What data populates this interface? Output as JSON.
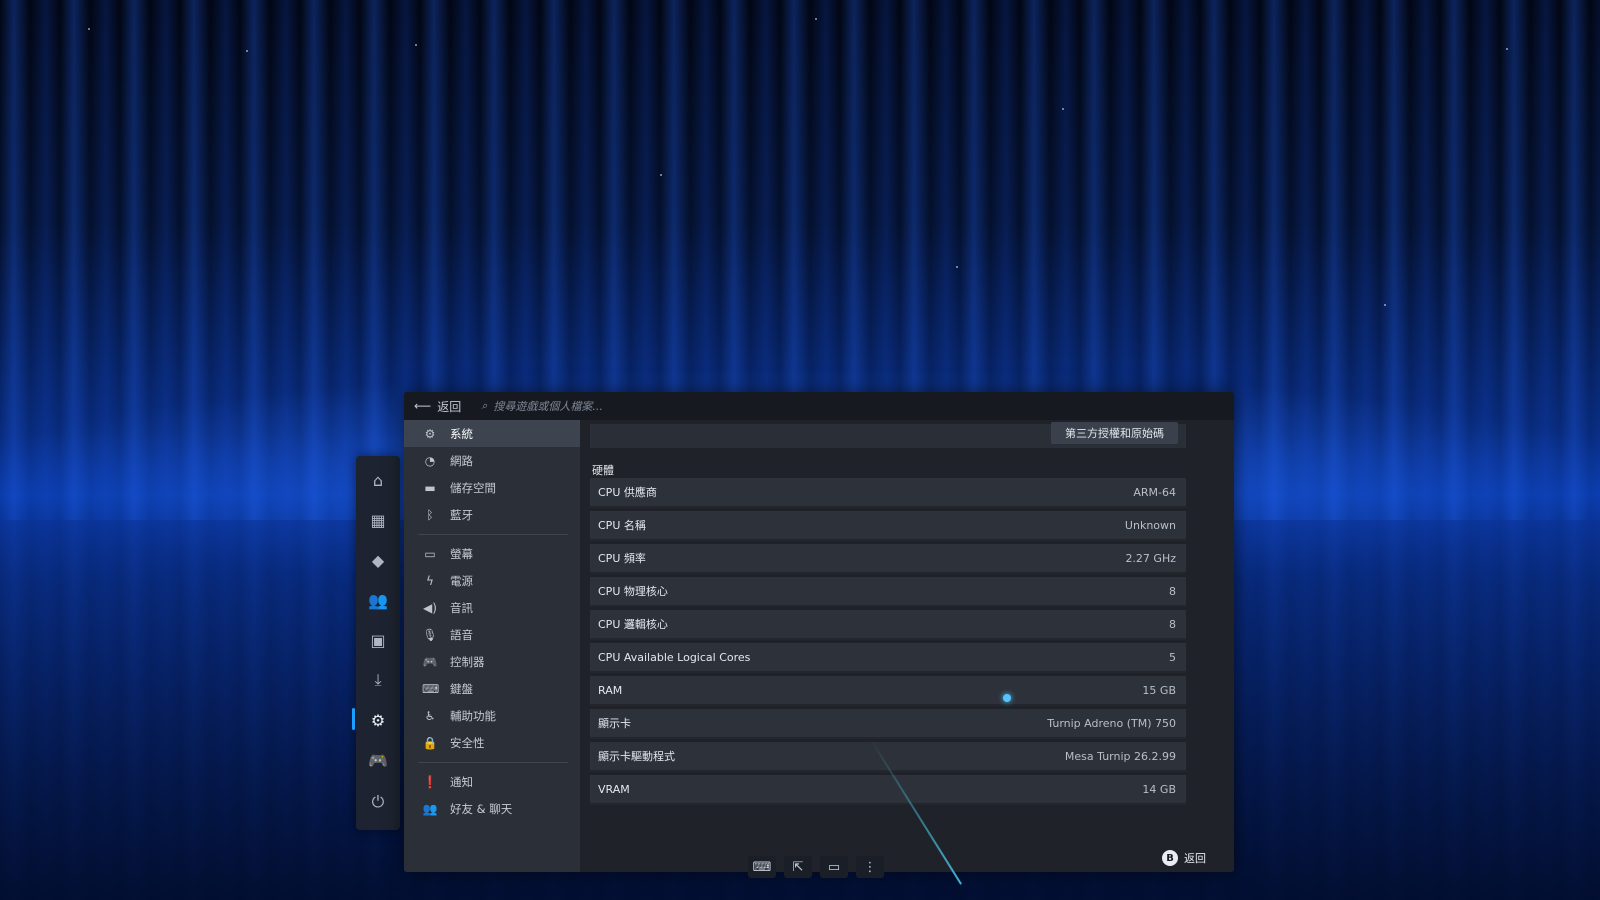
{
  "topbar": {
    "back_label": "返回",
    "search_placeholder": "搜尋遊戲或個人檔案..."
  },
  "nav": {
    "items": [
      {
        "label": "系統",
        "icon": "gear-icon",
        "active": true
      },
      {
        "label": "網路",
        "icon": "wifi-icon"
      },
      {
        "label": "儲存空間",
        "icon": "storage-icon"
      },
      {
        "label": "藍牙",
        "icon": "bluetooth-icon"
      },
      {
        "label": "螢幕",
        "icon": "monitor-icon"
      },
      {
        "label": "電源",
        "icon": "power-bolt-icon"
      },
      {
        "label": "音訊",
        "icon": "speaker-icon"
      },
      {
        "label": "語音",
        "icon": "microphone-icon"
      },
      {
        "label": "控制器",
        "icon": "gamepad-icon"
      },
      {
        "label": "鍵盤",
        "icon": "keyboard-icon"
      },
      {
        "label": "輔助功能",
        "icon": "accessibility-icon"
      },
      {
        "label": "安全性",
        "icon": "lock-icon"
      },
      {
        "label": "通知",
        "icon": "notification-icon"
      },
      {
        "label": "好友 & 聊天",
        "icon": "friends-icon"
      }
    ]
  },
  "content": {
    "license_button": "第三方授權和原始碼",
    "hardware_heading": "硬體",
    "hardware": [
      {
        "label": "CPU 供應商",
        "value": "ARM-64"
      },
      {
        "label": "CPU 名稱",
        "value": "Unknown"
      },
      {
        "label": "CPU 頻率",
        "value": "2.27 GHz"
      },
      {
        "label": "CPU 物理核心",
        "value": "8"
      },
      {
        "label": "CPU 邏輯核心",
        "value": "8"
      },
      {
        "label": "CPU Available Logical Cores",
        "value": "5"
      },
      {
        "label": "RAM",
        "value": "15 GB"
      },
      {
        "label": "顯示卡",
        "value": "Turnip Adreno (TM) 750"
      },
      {
        "label": "顯示卡驅動程式",
        "value": "Mesa Turnip 26.2.99"
      },
      {
        "label": "VRAM",
        "value": "14 GB"
      }
    ],
    "footer_button": "B",
    "footer_label": "返回"
  },
  "rail": {
    "icons": [
      "home-icon",
      "grid-icon",
      "tag-icon",
      "friends-icon",
      "media-icon",
      "download-icon",
      "settings-icon",
      "controller-icon",
      "power-icon"
    ],
    "active_index": 6
  },
  "toolbar": {
    "icons": [
      "keyboard-icon",
      "open-external-icon",
      "display-icon",
      "more-icon"
    ]
  }
}
